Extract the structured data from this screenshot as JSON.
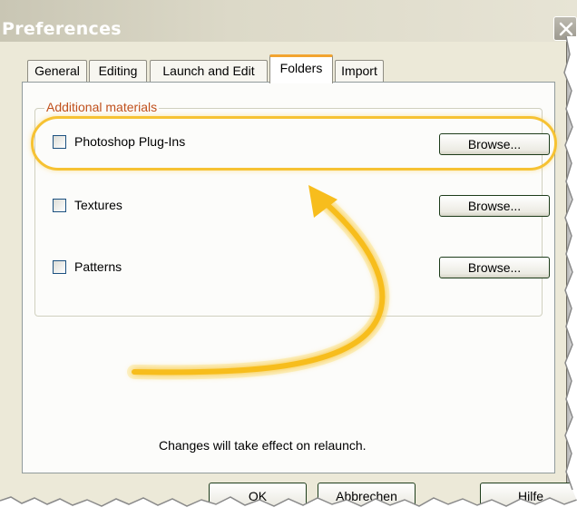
{
  "window": {
    "title": "Preferences"
  },
  "tabs": [
    {
      "label": "General"
    },
    {
      "label": "Editing"
    },
    {
      "label": "Launch and Edit"
    },
    {
      "label": "Folders",
      "active": true
    },
    {
      "label": "Import"
    }
  ],
  "group": {
    "label": "Additional materials",
    "items": [
      {
        "label": "Photoshop Plug-Ins",
        "checked": false,
        "button": "Browse..."
      },
      {
        "label": "Textures",
        "checked": false,
        "button": "Browse..."
      },
      {
        "label": "Patterns",
        "checked": false,
        "button": "Browse..."
      }
    ]
  },
  "status": "Changes will take effect on relaunch.",
  "buttons": {
    "ok": "OK",
    "cancel": "Abbrechen",
    "help": "Hilfe"
  },
  "colors": {
    "highlight": "#f6c233",
    "active_tab_accent": "#f2a430",
    "group_label": "#c0501c"
  },
  "icons": {
    "close": "close-icon",
    "annotation": "curved-arrow-icon"
  }
}
